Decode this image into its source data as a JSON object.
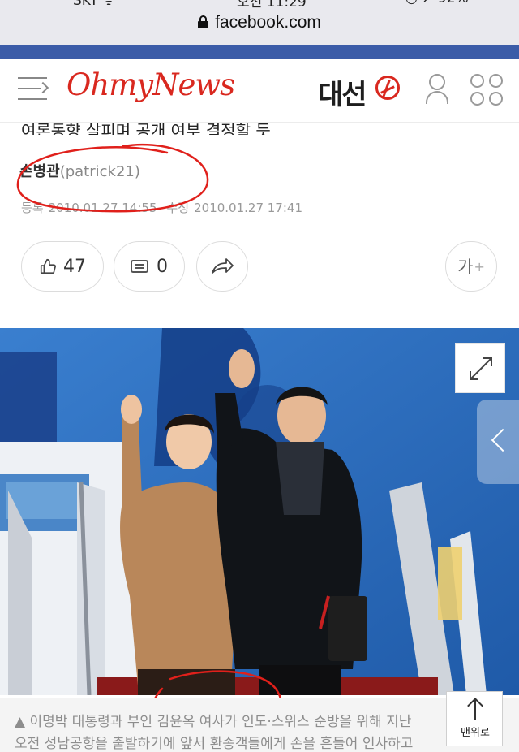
{
  "browser": {
    "status_left": "SKT ᯤ",
    "status_center": "오전 11:29",
    "status_right": "◔ ↗ 92%",
    "url": "facebook.com"
  },
  "header": {
    "logo": "OhmyNews",
    "election_label": "대선"
  },
  "article": {
    "subtitle": "여론동향 살피며 공개 여부 결정할 듯",
    "author_name": "손병관",
    "author_id": "(patrick21)",
    "registered_label": "등록",
    "registered_date": "2010.01.27 14:55",
    "modified_label": "수정",
    "modified_date": "2010.01.27 17:41"
  },
  "actions": {
    "like_count": "47",
    "comment_count": "0",
    "font_size_label": "가",
    "font_size_plus": "+"
  },
  "photo": {
    "caption_line1": "▲ 이명박 대통령과 부인 김윤옥 여사가 인도·스위스 순방을 위해 지난",
    "caption_line2": "오전 성남공항을 출발하기에 앞서 환송객들에게 손을 흔들어 인사하고"
  },
  "scroll_top": {
    "label": "맨위로"
  },
  "colors": {
    "brand_red": "#d9281f",
    "facebook_blue": "#3b5ca8",
    "annotation_red": "#e0201b"
  }
}
